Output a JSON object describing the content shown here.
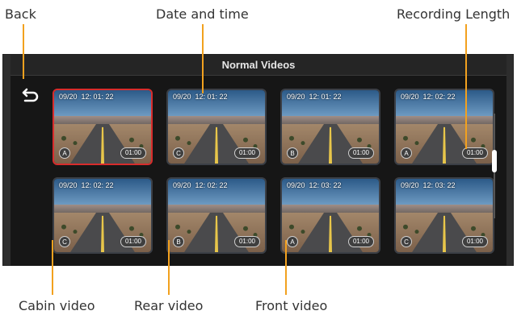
{
  "callouts": {
    "back": "Back",
    "date_time": "Date and time",
    "recording_length": "Recording Length",
    "cabin_video": "Cabin video",
    "rear_video": "Rear video",
    "front_video": "Front video"
  },
  "screen": {
    "title": "Normal Videos",
    "back_icon": "back-arrow-icon"
  },
  "videos": [
    {
      "timestamp": "09/20  12: 01: 22",
      "camera": "A",
      "duration": "01:00",
      "selected": true
    },
    {
      "timestamp": "09/20  12: 01: 22",
      "camera": "C",
      "duration": "01:00",
      "selected": false
    },
    {
      "timestamp": "09/20  12: 01: 22",
      "camera": "B",
      "duration": "01:00",
      "selected": false
    },
    {
      "timestamp": "09/20  12: 02: 22",
      "camera": "A",
      "duration": "01:00",
      "selected": false
    },
    {
      "timestamp": "09/20  12: 02: 22",
      "camera": "C",
      "duration": "01:00",
      "selected": false
    },
    {
      "timestamp": "09/20  12: 02: 22",
      "camera": "B",
      "duration": "01:00",
      "selected": false
    },
    {
      "timestamp": "09/20  12: 03: 22",
      "camera": "A",
      "duration": "01:00",
      "selected": false
    },
    {
      "timestamp": "09/20  12: 03: 22",
      "camera": "C",
      "duration": "01:00",
      "selected": false
    }
  ],
  "colors": {
    "accent_line": "#f2a11f",
    "selected_border": "#d82c2c"
  }
}
